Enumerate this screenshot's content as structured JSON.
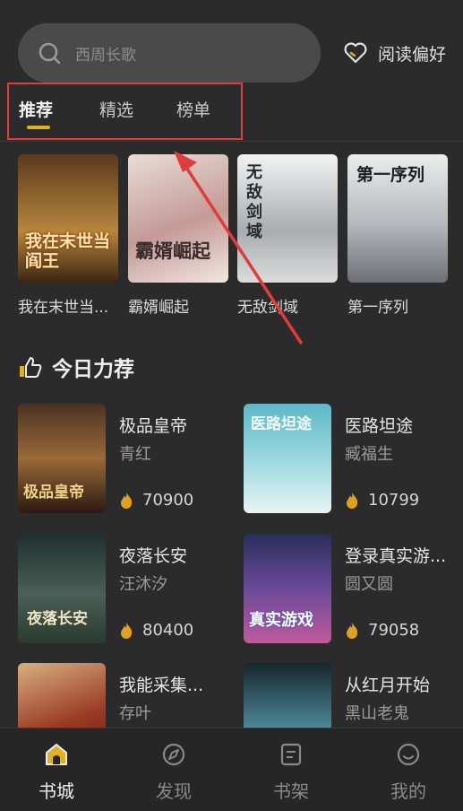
{
  "search": {
    "placeholder": "西周长歌"
  },
  "preference": {
    "label": "阅读偏好"
  },
  "tabs": [
    {
      "label": "推荐",
      "active": true
    },
    {
      "label": "精选",
      "active": false
    },
    {
      "label": "榜单",
      "active": false
    }
  ],
  "recommend": [
    {
      "title": "我在末世当...",
      "cover_text": "我在末世当阎王",
      "colors": [
        "#6b4a2a",
        "#c9a45a"
      ]
    },
    {
      "title": "霸婿崛起",
      "cover_text": "霸婿崛起",
      "colors": [
        "#caa9a6",
        "#e8d6d2"
      ]
    },
    {
      "title": "无敌剑域",
      "cover_text": "无敌剑域",
      "colors": [
        "#b9bcc0",
        "#e9e9e9"
      ]
    },
    {
      "title": "第一序列",
      "cover_text": "第一序列",
      "colors": [
        "#a9adb3",
        "#d8dadd"
      ]
    }
  ],
  "section": {
    "title": "今日力荐"
  },
  "books": [
    {
      "title": "极品皇帝",
      "author": "青红",
      "heat": "70900",
      "cover_text": "极品皇帝",
      "colors": [
        "#3d2a20",
        "#b07a3a"
      ]
    },
    {
      "title": "医路坦途",
      "author": "臧福生",
      "heat": "10799",
      "cover_text": "医路坦途",
      "colors": [
        "#6fc2cf",
        "#a9e0e6"
      ]
    },
    {
      "title": "夜落长安",
      "author": "汪沐汐",
      "heat": "80400",
      "cover_text": "夜落长安",
      "colors": [
        "#243a34",
        "#6b7f6a"
      ]
    },
    {
      "title": "登录真实游...",
      "author": "圆又圆",
      "heat": "79058",
      "cover_text": "真实游戏",
      "colors": [
        "#2a2e5a",
        "#8a5fb0"
      ]
    },
    {
      "title": "我能采集...",
      "author": "存叶",
      "heat": "",
      "cover_text": "",
      "colors": [
        "#7a2a20",
        "#d0a070"
      ]
    },
    {
      "title": "从红月开始",
      "author": "黑山老鬼",
      "heat": "",
      "cover_text": "",
      "colors": [
        "#1e3a44",
        "#7ab0c0"
      ]
    }
  ],
  "nav": [
    {
      "label": "书城",
      "icon": "store-icon",
      "active": true
    },
    {
      "label": "发现",
      "icon": "discover-icon",
      "active": false
    },
    {
      "label": "书架",
      "icon": "bookshelf-icon",
      "active": false
    },
    {
      "label": "我的",
      "icon": "profile-icon",
      "active": false
    }
  ],
  "colors": {
    "accent": "#e0b020",
    "annotation": "#e23b3b",
    "background": "#2b2b2b"
  }
}
